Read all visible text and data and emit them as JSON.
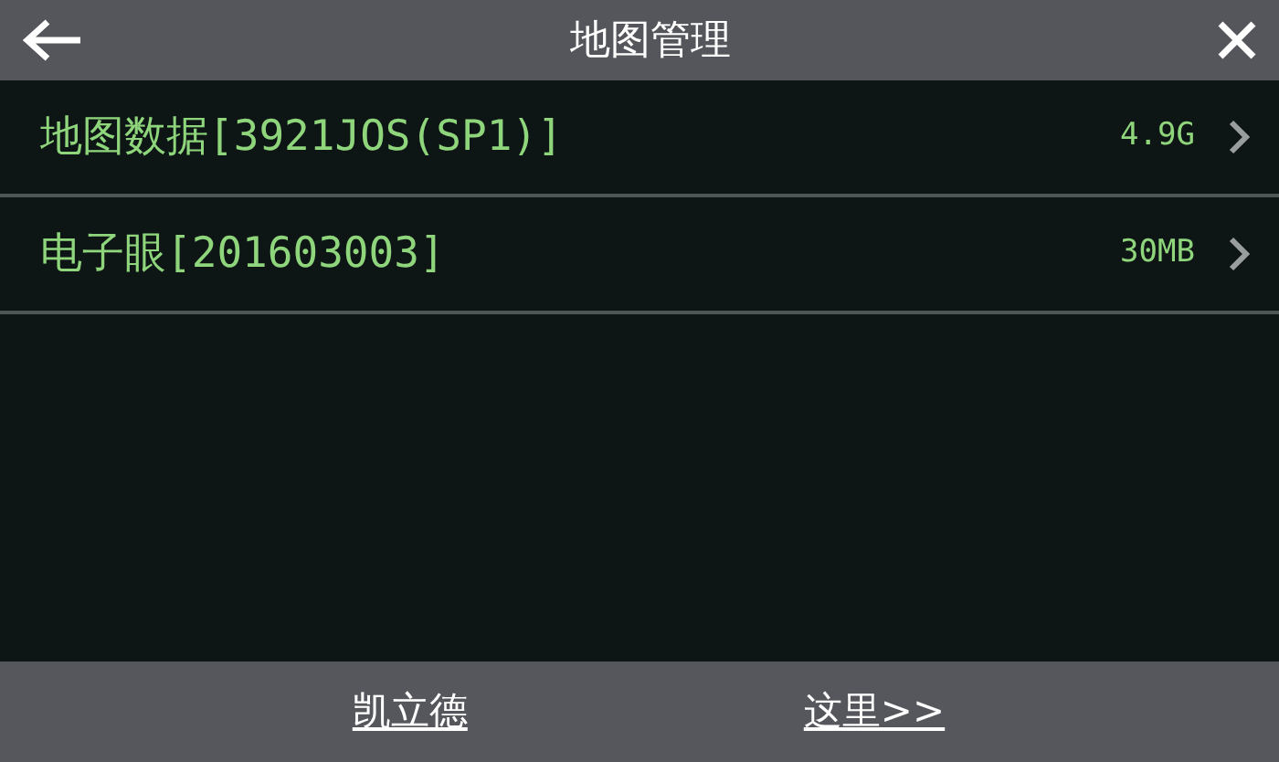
{
  "header": {
    "title": "地图管理"
  },
  "items": [
    {
      "name": "地图数据[3921JOS(SP1)]",
      "size": "4.9G"
    },
    {
      "name": "电子眼[201603003]",
      "size": "30MB"
    }
  ],
  "footer": {
    "link_parts": [
      "凯立德",
      "这里>>"
    ]
  }
}
